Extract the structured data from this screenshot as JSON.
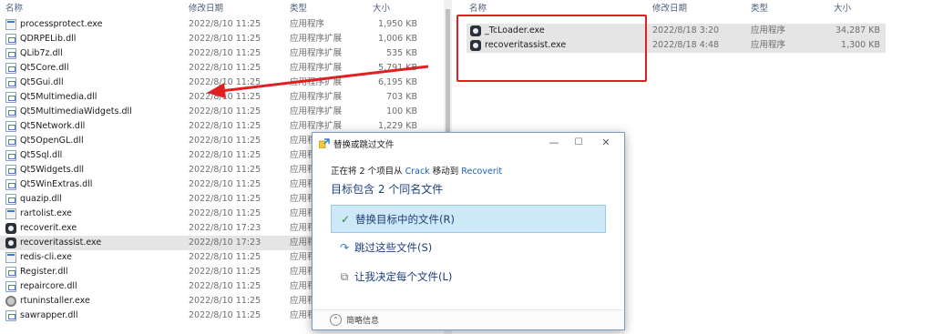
{
  "left_explorer": {
    "headers": {
      "name": "名称",
      "date": "修改日期",
      "type": "类型",
      "size": "大小"
    },
    "files": [
      {
        "name": "processprotect.exe",
        "date": "2022/8/10 11:25",
        "type": "应用程序",
        "size": "1,950 KB",
        "icon": "exe-icon"
      },
      {
        "name": "QDRPELib.dll",
        "date": "2022/8/10 11:25",
        "type": "应用程序扩展",
        "size": "1,006 KB",
        "icon": "dll-icon"
      },
      {
        "name": "QLib7z.dll",
        "date": "2022/8/10 11:25",
        "type": "应用程序扩展",
        "size": "535 KB",
        "icon": "dll-icon"
      },
      {
        "name": "Qt5Core.dll",
        "date": "2022/8/10 11:25",
        "type": "应用程序扩展",
        "size": "5,791 KB",
        "icon": "dll-icon"
      },
      {
        "name": "Qt5Gui.dll",
        "date": "2022/8/10 11:25",
        "type": "应用程序扩展",
        "size": "6,195 KB",
        "icon": "dll-icon"
      },
      {
        "name": "Qt5Multimedia.dll",
        "date": "2022/8/10 11:25",
        "type": "应用程序扩展",
        "size": "703 KB",
        "icon": "dll-icon"
      },
      {
        "name": "Qt5MultimediaWidgets.dll",
        "date": "2022/8/10 11:25",
        "type": "应用程序扩展",
        "size": "100 KB",
        "icon": "dll-icon"
      },
      {
        "name": "Qt5Network.dll",
        "date": "2022/8/10 11:25",
        "type": "应用程序扩展",
        "size": "1,229 KB",
        "icon": "dll-icon"
      },
      {
        "name": "Qt5OpenGL.dll",
        "date": "2022/8/10 11:25",
        "type": "应用程序",
        "size": "",
        "icon": "dll-icon"
      },
      {
        "name": "Qt5Sql.dll",
        "date": "2022/8/10 11:25",
        "type": "应用程",
        "size": "",
        "icon": "dll-icon"
      },
      {
        "name": "Qt5Widgets.dll",
        "date": "2022/8/10 11:25",
        "type": "应用程",
        "size": "",
        "icon": "dll-icon"
      },
      {
        "name": "Qt5WinExtras.dll",
        "date": "2022/8/10 11:25",
        "type": "应用程",
        "size": "",
        "icon": "dll-icon"
      },
      {
        "name": "quazip.dll",
        "date": "2022/8/10 11:25",
        "type": "应用程",
        "size": "",
        "icon": "dll-icon"
      },
      {
        "name": "rartolist.exe",
        "date": "2022/8/10 11:25",
        "type": "应用程",
        "size": "",
        "icon": "exe-icon"
      },
      {
        "name": "recoverit.exe",
        "date": "2022/8/10 17:23",
        "type": "应用程",
        "size": "",
        "icon": "app-icon"
      },
      {
        "name": "recoveritassist.exe",
        "date": "2022/8/10 17:23",
        "type": "应用程",
        "size": "",
        "icon": "app-icon"
      },
      {
        "name": "redis-cli.exe",
        "date": "2022/8/10 11:25",
        "type": "应用程",
        "size": "",
        "icon": "exe-icon"
      },
      {
        "name": "Register.dll",
        "date": "2022/8/10 11:25",
        "type": "应用程",
        "size": "",
        "icon": "dll-icon"
      },
      {
        "name": "repaircore.dll",
        "date": "2022/8/10 11:25",
        "type": "应用程",
        "size": "",
        "icon": "dll-icon"
      },
      {
        "name": "rtuninstaller.exe",
        "date": "2022/8/10 11:25",
        "type": "应用程",
        "size": "",
        "icon": "gear-icon"
      },
      {
        "name": "sawrapper.dll",
        "date": "2022/8/10 11:25",
        "type": "应用程",
        "size": "",
        "icon": "dll-icon"
      }
    ],
    "selected_index": 15
  },
  "right_explorer": {
    "headers": {
      "name": "名称",
      "date": "修改日期",
      "type": "类型",
      "size": "大小"
    },
    "files": [
      {
        "name": "_TcLoader.exe",
        "date": "2022/8/18 3:20",
        "type": "应用程序",
        "size": "34,287 KB",
        "icon": "app-icon"
      },
      {
        "name": "recoveritassist.exe",
        "date": "2022/8/18 4:48",
        "type": "应用程序",
        "size": "1,300 KB",
        "icon": "app-icon"
      }
    ]
  },
  "dialog": {
    "title": "替换或跳过文件",
    "line_prefix": "正在将 2 个项目从",
    "source": "Crack",
    "line_middle": "移动到",
    "destination": "Recoverit",
    "heading": "目标包含 2 个同名文件",
    "options": [
      {
        "label": "替换目标中的文件(R)",
        "icon": "check-icon",
        "glyph": "✓",
        "highlighted": true
      },
      {
        "label": "跳过这些文件(S)",
        "icon": "skip-icon",
        "glyph": "↷",
        "highlighted": false
      },
      {
        "label": "让我决定每个文件(L)",
        "icon": "compare-icon",
        "glyph": "⧉",
        "highlighted": false
      }
    ],
    "footer": {
      "toggle_glyph": "⌃",
      "label": "简略信息"
    }
  },
  "colors": {
    "annotation_red": "#e02020",
    "highlight": "#cde8f6",
    "link": "#1a62b0"
  }
}
